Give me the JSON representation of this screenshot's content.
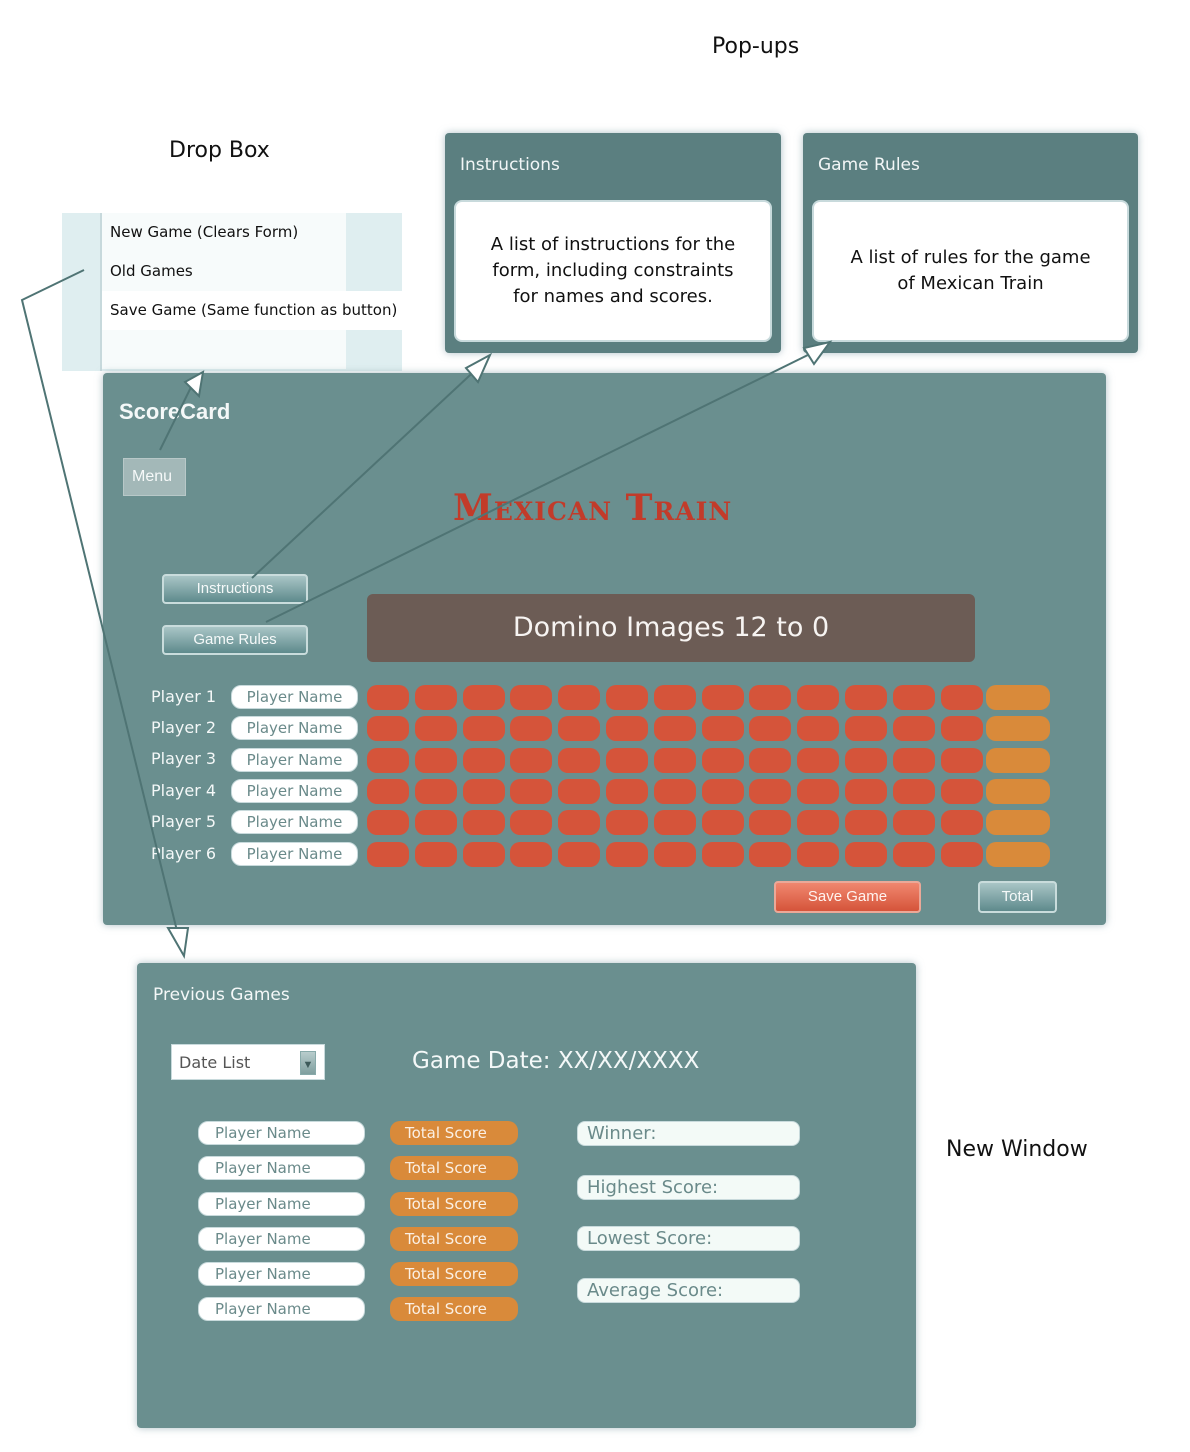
{
  "labels": {
    "popups": "Pop-ups",
    "drop_box": "Drop Box",
    "new_window": "New Window"
  },
  "dropbox": {
    "items": [
      "New Game (Clears Form)",
      "Old Games",
      "Save Game (Same function as button)",
      ""
    ]
  },
  "popup_instructions": {
    "title": "Instructions",
    "body": "A list of instructions for the form, including constraints for names and scores."
  },
  "popup_rules": {
    "title": "Game Rules",
    "body": "A list of rules for the game of Mexican Train"
  },
  "scorecard": {
    "title": "ScoreCard",
    "menu_label": "Menu",
    "main_title": "Mexican Train",
    "instructions_label": "Instructions",
    "rules_label": "Game Rules",
    "domino_label": "Domino Images 12 to 0",
    "players": [
      {
        "label": "Player 1",
        "name_placeholder": "Player Name"
      },
      {
        "label": "Player 2",
        "name_placeholder": "Player Name"
      },
      {
        "label": "Player 3",
        "name_placeholder": "Player Name"
      },
      {
        "label": "Player 4",
        "name_placeholder": "Player Name"
      },
      {
        "label": "Player 5",
        "name_placeholder": "Player Name"
      },
      {
        "label": "Player 6",
        "name_placeholder": "Player Name"
      }
    ],
    "save_label": "Save Game",
    "total_label": "Total"
  },
  "previous_games": {
    "title": "Previous Games",
    "date_list_label": "Date List",
    "game_date": "Game Date:  XX/XX/XXXX",
    "rows": [
      {
        "name": "Player Name",
        "score": "Total Score"
      },
      {
        "name": "Player Name",
        "score": "Total Score"
      },
      {
        "name": "Player Name",
        "score": "Total Score"
      },
      {
        "name": "Player Name",
        "score": "Total Score"
      },
      {
        "name": "Player Name",
        "score": "Total Score"
      },
      {
        "name": "Player Name",
        "score": "Total Score"
      }
    ],
    "stats": [
      "Winner:",
      "Highest Score:",
      "Lowest Score:",
      "Average Score:"
    ]
  },
  "colors": {
    "panel": "#6a8f8f",
    "popup_header": "#5b7f80",
    "cell": "#d5543a",
    "total_cell": "#d98a3a",
    "title_red": "#c23b2a",
    "domino_bg": "#6c5c55"
  }
}
